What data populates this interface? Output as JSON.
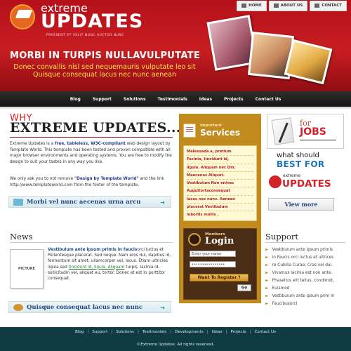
{
  "header": {
    "logo_extreme": "extreme",
    "logo_updates": "UPDATES",
    "tagline": "PRAESENT ET VELIT NUNC AUCTOR NUNC",
    "hero_title": "MORBI IN TURPIS NULLAVULPUTATE",
    "hero_sub": "Donec convallis nisl sed nequemauris vulputate leo sit Quisque consequat lacus nec nunc aenean"
  },
  "topnav": [
    {
      "label": "HOME",
      "icon": "home-icon"
    },
    {
      "label": "ABOUT US",
      "icon": "user-icon"
    },
    {
      "label": "CONTACT",
      "icon": "envelope-icon"
    }
  ],
  "mainnav": [
    "Blog",
    "Support",
    "Solutions",
    "Testimonials",
    "Ideas",
    "Projects",
    "Contact Us"
  ],
  "why": {
    "small": "WHY",
    "title": "EXTREME UPDATES...",
    "p1_start": "Extreme Updates is a ",
    "p1_bold": "free, tableless, W3C-compliant",
    "p1_mid": " web design layout by Template World. This template has been tested and proven compatible with all major browser environments and operating systems. You are free to modify the design to suit your tastes in any way you like.",
    "p2_start": "We only ask you to not remove ",
    "p2_bold": "\"Design by Template World\"",
    "p2_end": " and the link http://www.templateworld.com from the footer of the template."
  },
  "bars": {
    "bar1": "Morbi vel nunc aecenas urna arcu",
    "bar2": "Quisque consequat lacus nec nunc"
  },
  "news": {
    "title": "News",
    "picture": "PICTURE",
    "link": "Vestibulum ante ipsum primis in faucis",
    "text1": "orci luctus et Pellentesque placerat. Sed neque. Nam eros dui, dapibus id, fermentum sit amet, ullamcorper vel, lacus. Etiam ultricies ligula sed",
    "glink": "tincidunt id, ligula. Aliquam",
    "text2": " turpis, lacinia id, sollicitudin vel, aliquet eu, tortor. Donec et est in porttitor consequat."
  },
  "services": {
    "small": "Important",
    "big": "Services",
    "items": [
      "Malesuada a, pretium",
      "Facinia, tincidunt id,",
      "ligula. Aliquam nec Dm.",
      "Maecenas Aliquet.",
      "Vestibulum Non eninec",
      "AuguItortaconsequat",
      "lacus nec nunc. Aenean",
      "placerat Vestibulum",
      "lobortis mollis ."
    ]
  },
  "login": {
    "small": "Members",
    "big": "Login",
    "name_placeholder": "Enter your name",
    "password_value": "••••••••••••••••",
    "register": "Want To Register ?",
    "go": "Go"
  },
  "right": {
    "for": "for",
    "jobs": "JOBS",
    "what_should": "what should",
    "best_for": "BEST FOR",
    "promo_extreme": "extreme",
    "promo_updates": "UPDATES",
    "view_more": "View more"
  },
  "support": {
    "title": "Support",
    "items": [
      "Vestibulum ante ipsum primis",
      "in Faucis orci luctus et ultrices",
      "re Cubilia Curae; Cras vel dui.",
      "Vivamus lacinia est non ante.",
      "Phasellus elit tellus, condimid,",
      "Euismod",
      "Vestibulum ante ipsum prim in",
      "Faucibusorci"
    ]
  },
  "footer": {
    "links": [
      "Blog",
      "Support",
      "Solutions",
      "Testimonials",
      "Developments",
      "Ideas",
      "Projects",
      "Contact Us"
    ],
    "copyright": "©Extreme Updates. All rights reserved."
  },
  "colors": {
    "header_red": "#c81e22",
    "nav_black": "#151515",
    "services_gold": "#c28b1e",
    "footer_teal": "#0f3b43",
    "link_blue": "#23467d"
  }
}
